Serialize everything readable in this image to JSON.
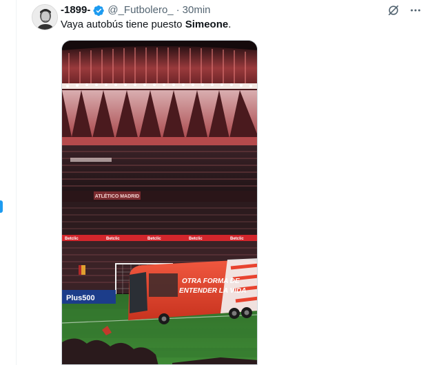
{
  "tweet": {
    "display_name": "-1899-",
    "handle": "@_Futbolero_",
    "separator": "·",
    "time": "30min",
    "text_before": "Vaya autobús tiene puesto ",
    "text_bold": "Simeone",
    "text_after": "."
  },
  "media": {
    "banner_text": "ATLÉTICO MADRID",
    "ad_text": "Betclic",
    "board_text": "Plus500",
    "bus_text_line1": "OTRA FORMA DE",
    "bus_text_line2": "ENTENDER LA VIDA"
  },
  "colors": {
    "verified": "#1d9bf0",
    "accent": "#1d9bf0",
    "bus": "#e8432f",
    "pitch": "#2f7a2c"
  },
  "icons": {
    "verified": "verified-badge-icon",
    "grok": "grok-icon",
    "more": "more-icon"
  }
}
